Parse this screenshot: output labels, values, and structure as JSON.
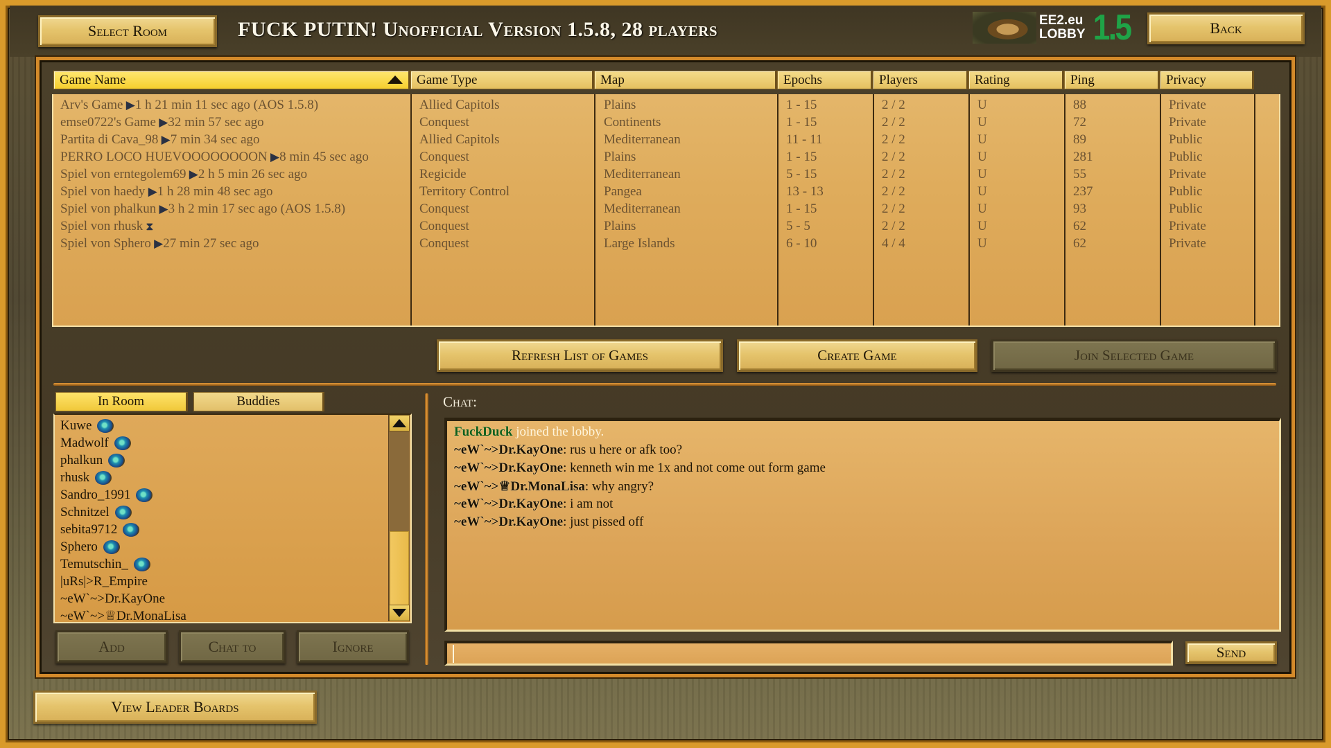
{
  "header": {
    "select_room_label": "Select Room",
    "title": "FUCK PUTIN! Unofficial Version 1.5.8, 28 players",
    "logo": {
      "line1": "EE2.eu",
      "line2": "LOBBY",
      "version": "1.5",
      "version_color": "#1fa347"
    },
    "back_label": "Back"
  },
  "games_table": {
    "columns": [
      "Game Name",
      "Game Type",
      "Map",
      "Epochs",
      "Players",
      "Rating",
      "Ping",
      "Privacy"
    ],
    "sorted_column": "Game Name",
    "sort_direction": "ascending",
    "rows": [
      {
        "name": "Arv's Game",
        "status_icon": "play-arrow",
        "status": "1 h 21 min 11 sec ago (AOS 1.5.8)",
        "type": "Allied Capitols",
        "map": "Plains",
        "epochs": "1 - 15",
        "players": "2 / 2",
        "rating": "U",
        "ping": "88",
        "privacy": "Private"
      },
      {
        "name": "emse0722's Game",
        "status_icon": "play-arrow",
        "status": "32 min 57 sec ago",
        "type": "Conquest",
        "map": "Continents",
        "epochs": "1 - 15",
        "players": "2 / 2",
        "rating": "U",
        "ping": "72",
        "privacy": "Private"
      },
      {
        "name": "Partita di Cava_98",
        "status_icon": "play-arrow",
        "status": "7 min 34 sec ago",
        "type": "Allied Capitols",
        "map": "Mediterranean",
        "epochs": "11 - 11",
        "players": "2 / 2",
        "rating": "U",
        "ping": "89",
        "privacy": "Public"
      },
      {
        "name": "PERRO LOCO HUEVOOOOOOOON",
        "status_icon": "play-arrow",
        "status": "8 min 45 sec ago",
        "type": "Conquest",
        "map": "Plains",
        "epochs": "1 - 15",
        "players": "2 / 2",
        "rating": "U",
        "ping": "281",
        "privacy": "Public"
      },
      {
        "name": "Spiel von erntegolem69",
        "status_icon": "play-arrow",
        "status": "2 h 5 min 26 sec ago",
        "type": "Regicide",
        "map": "Mediterranean",
        "epochs": "5 - 15",
        "players": "2 / 2",
        "rating": "U",
        "ping": "55",
        "privacy": "Private"
      },
      {
        "name": "Spiel von haedy",
        "status_icon": "play-arrow",
        "status": "1 h 28 min 48 sec ago",
        "type": "Territory Control",
        "map": "Pangea",
        "epochs": "13 - 13",
        "players": "2 / 2",
        "rating": "U",
        "ping": "237",
        "privacy": "Public"
      },
      {
        "name": "Spiel von phalkun",
        "status_icon": "play-arrow",
        "status": "3 h 2 min 17 sec ago (AOS 1.5.8)",
        "type": "Conquest",
        "map": "Mediterranean",
        "epochs": "1 - 15",
        "players": "2 / 2",
        "rating": "U",
        "ping": "93",
        "privacy": "Public"
      },
      {
        "name": "Spiel von rhusk",
        "status_icon": "hourglass",
        "status": "",
        "type": "Conquest",
        "map": "Plains",
        "epochs": "5 - 5",
        "players": "2 / 2",
        "rating": "U",
        "ping": "62",
        "privacy": "Private"
      },
      {
        "name": "Spiel von Sphero",
        "status_icon": "play-arrow",
        "status": "27 min 27 sec ago",
        "type": "Conquest",
        "map": "Large Islands",
        "epochs": "6 - 10",
        "players": "4 / 4",
        "rating": "U",
        "ping": "62",
        "privacy": "Private"
      }
    ]
  },
  "actions": {
    "refresh_label": "Refresh List of Games",
    "create_label": "Create Game",
    "join_label": "Join Selected Game"
  },
  "players_panel": {
    "tabs": [
      {
        "label": "In Room",
        "active": true
      },
      {
        "label": "Buddies",
        "active": false
      }
    ],
    "players": [
      {
        "name": "Kuwe",
        "globe": true
      },
      {
        "name": "Madwolf",
        "globe": true
      },
      {
        "name": "phalkun",
        "globe": true
      },
      {
        "name": "rhusk",
        "globe": true
      },
      {
        "name": "Sandro_1991",
        "globe": true
      },
      {
        "name": "Schnitzel",
        "globe": true
      },
      {
        "name": "sebita9712",
        "globe": true
      },
      {
        "name": "Sphero",
        "globe": true
      },
      {
        "name": "Temutschin_",
        "globe": true
      },
      {
        "name": "|uRs|>R_Empire",
        "globe": false
      },
      {
        "name": "~eW`~>Dr.KayOne",
        "globe": false
      },
      {
        "name": "~eW`~>♕Dr.MonaLisa",
        "globe": false
      }
    ],
    "scroll_position": 0.72,
    "add_label": "Add",
    "chat_to_label": "Chat to",
    "ignore_label": "Ignore"
  },
  "chat": {
    "label": "Chat:",
    "messages": [
      {
        "sender": "FuckDuck",
        "text": " joined the lobby.",
        "type": "system"
      },
      {
        "sender": "~eW`~>Dr.KayOne",
        "text": ": rus  u here or afk too?",
        "type": "chat"
      },
      {
        "sender": "~eW`~>Dr.KayOne",
        "text": ": kenneth win me 1x and not come out form game",
        "type": "chat"
      },
      {
        "sender": "~eW`~>♕Dr.MonaLisa",
        "text": ": why angry?",
        "type": "chat"
      },
      {
        "sender": "~eW`~>Dr.KayOne",
        "text": ": i am not",
        "type": "chat"
      },
      {
        "sender": "~eW`~>Dr.KayOne",
        "text": ": just pissed off",
        "type": "chat"
      }
    ],
    "input_value": "",
    "send_label": "Send"
  },
  "footer": {
    "leaderboards_label": "View Leader Boards"
  }
}
